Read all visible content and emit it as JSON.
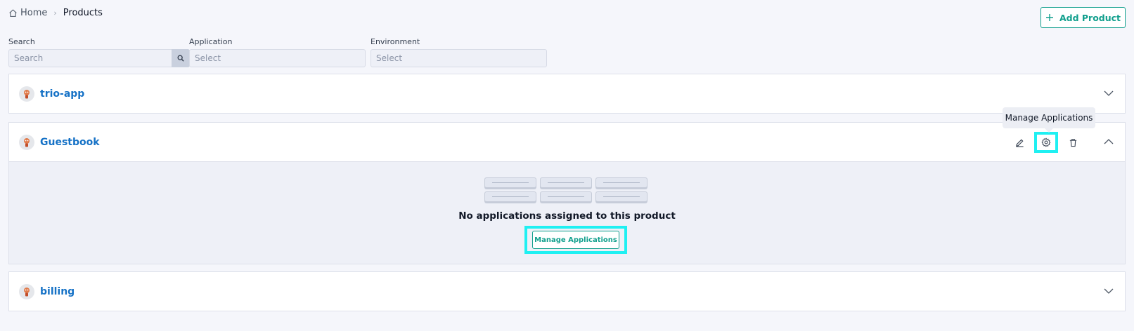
{
  "breadcrumb": {
    "home": "Home",
    "current": "Products"
  },
  "header": {
    "add_button": "Add Product"
  },
  "filters": {
    "search": {
      "label": "Search",
      "placeholder": "Search"
    },
    "application": {
      "label": "Application",
      "placeholder": "Select"
    },
    "environment": {
      "label": "Environment",
      "placeholder": "Select"
    }
  },
  "products": [
    {
      "name": "trio-app",
      "expanded": false
    },
    {
      "name": "Guestbook",
      "expanded": true
    },
    {
      "name": "billing",
      "expanded": false
    }
  ],
  "expanded_panel": {
    "empty_message": "No applications assigned to this product",
    "manage_button": "Manage Applications"
  },
  "tooltip": {
    "text": "Manage Applications"
  },
  "icons": [
    "home-icon",
    "chevron-right-icon",
    "plus-icon",
    "search-icon",
    "product-avatar-icon",
    "chevron-down-icon",
    "chevron-up-icon",
    "edit-icon",
    "gear-icon",
    "trash-icon"
  ],
  "colors": {
    "accent": "#119f8d",
    "link": "#1672c6",
    "highlight": "#1ff0f2"
  }
}
